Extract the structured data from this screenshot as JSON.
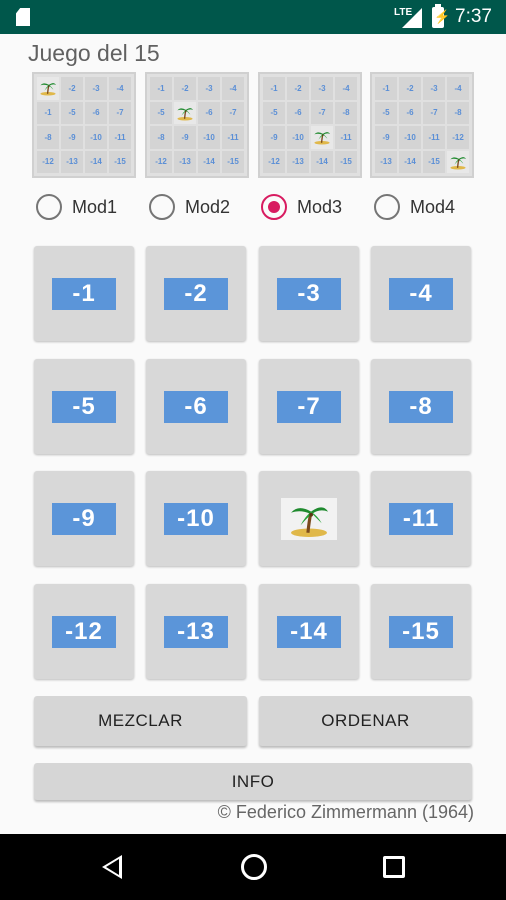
{
  "status_bar": {
    "network": "LTE",
    "time": "7:37"
  },
  "app": {
    "title": "Juego del 15"
  },
  "modes": [
    {
      "label": "Mod1",
      "checked": false
    },
    {
      "label": "Mod2",
      "checked": false
    },
    {
      "label": "Mod3",
      "checked": true
    },
    {
      "label": "Mod4",
      "checked": false
    }
  ],
  "previews": [
    [
      "palm",
      "-2",
      "-3",
      "-4",
      "-1",
      "-5",
      "-6",
      "-7",
      "-8",
      "-9",
      "-10",
      "-11",
      "-12",
      "-13",
      "-14",
      "-15"
    ],
    [
      "-1",
      "-2",
      "-3",
      "-4",
      "-5",
      "palm",
      "-6",
      "-7",
      "-8",
      "-9",
      "-10",
      "-11",
      "-12",
      "-13",
      "-14",
      "-15"
    ],
    [
      "-1",
      "-2",
      "-3",
      "-4",
      "-5",
      "-6",
      "-7",
      "-8",
      "-9",
      "-10",
      "palm",
      "-11",
      "-12",
      "-13",
      "-14",
      "-15"
    ],
    [
      "-1",
      "-2",
      "-3",
      "-4",
      "-5",
      "-6",
      "-7",
      "-8",
      "-9",
      "-10",
      "-11",
      "-12",
      "-13",
      "-14",
      "-15",
      "palm"
    ]
  ],
  "board": [
    "-1",
    "-2",
    "-3",
    "-4",
    "-5",
    "-6",
    "-7",
    "-8",
    "-9",
    "-10",
    "palm",
    "-11",
    "-12",
    "-13",
    "-14",
    "-15"
  ],
  "buttons": {
    "shuffle": "MEZCLAR",
    "order": "ORDENAR",
    "info": "INFO"
  },
  "copyright": "© Federico Zimmermann (1964)",
  "icons": {
    "empty_tile": "palm-tree-island-icon"
  },
  "colors": {
    "status_bar": "#00574b",
    "tile_label": "#5b95d9",
    "radio_checked": "#d81b60"
  }
}
